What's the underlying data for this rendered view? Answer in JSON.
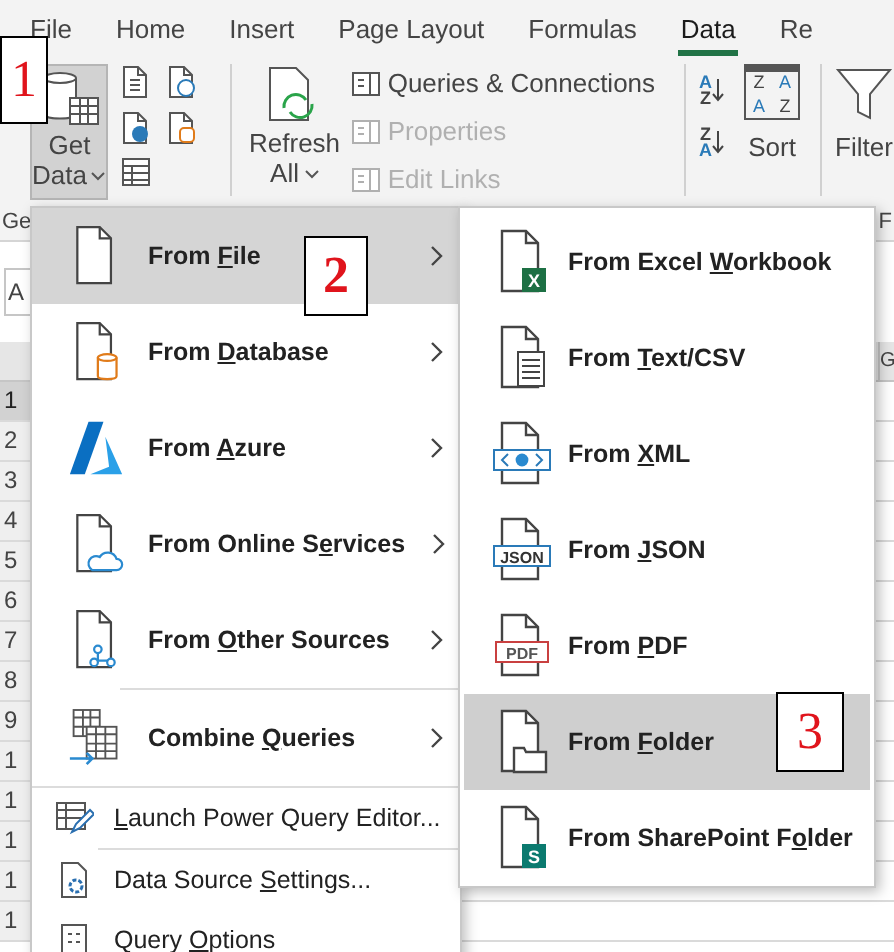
{
  "tabs": [
    {
      "label": "File",
      "selected": false
    },
    {
      "label": "Home",
      "selected": false
    },
    {
      "label": "Insert",
      "selected": false
    },
    {
      "label": "Page Layout",
      "selected": false
    },
    {
      "label": "Formulas",
      "selected": false
    },
    {
      "label": "Data",
      "selected": true
    },
    {
      "label": "Re",
      "selected": false
    }
  ],
  "ribbon": {
    "get_data": {
      "line1": "Get",
      "line2": "Data",
      "pressed": true
    },
    "refresh_all": {
      "line1": "Refresh",
      "line2": "All"
    },
    "commands": [
      {
        "label": "Queries & Connections",
        "disabled": false
      },
      {
        "label": "Properties",
        "disabled": true
      },
      {
        "label": "Edit Links",
        "disabled": true
      }
    ],
    "sort_ascending_letters": [
      "A",
      "Z"
    ],
    "sort_descending_letters": [
      "Z",
      "A"
    ],
    "sort_icon_letters": [
      "Z",
      "A",
      "A",
      "Z"
    ],
    "sort": "Sort",
    "filter": "Filter",
    "group_labels": [
      "Ge",
      "F"
    ]
  },
  "sheet": {
    "name_box": "A",
    "column_header": "G",
    "row_numbers": [
      {
        "label": "1",
        "selected": true
      },
      {
        "label": "2",
        "selected": false
      },
      {
        "label": "3",
        "selected": false
      },
      {
        "label": "4",
        "selected": false
      },
      {
        "label": "5",
        "selected": false
      },
      {
        "label": "6",
        "selected": false
      },
      {
        "label": "7",
        "selected": false
      },
      {
        "label": "8",
        "selected": false
      },
      {
        "label": "9",
        "selected": false
      },
      {
        "label": "1",
        "selected": false
      },
      {
        "label": "1",
        "selected": false
      },
      {
        "label": "1",
        "selected": false
      },
      {
        "label": "1",
        "selected": false
      },
      {
        "label": "1",
        "selected": false
      }
    ]
  },
  "menu": {
    "items": [
      {
        "kind": "large",
        "pre": "From ",
        "key": "F",
        "post": "ile",
        "has_submenu": true,
        "selected": true
      },
      {
        "kind": "large",
        "pre": "From ",
        "key": "D",
        "post": "atabase",
        "has_submenu": true,
        "selected": false
      },
      {
        "kind": "large",
        "pre": "From ",
        "key": "A",
        "post": "zure",
        "has_submenu": true,
        "selected": false
      },
      {
        "kind": "large",
        "pre": "From Online S",
        "key": "e",
        "post": "rvices",
        "has_submenu": true,
        "selected": false
      },
      {
        "kind": "large",
        "pre": "From ",
        "key": "O",
        "post": "ther Sources",
        "has_submenu": true,
        "selected": false
      },
      {
        "kind": "large",
        "pre": "Combine ",
        "key": "Q",
        "post": "ueries",
        "has_submenu": true,
        "selected": false
      },
      {
        "kind": "small",
        "key": "L",
        "post": "aunch Power Query Editor...",
        "has_submenu": false,
        "selected": false
      },
      {
        "kind": "small",
        "pre": "Data Source ",
        "key": "S",
        "post": "ettings...",
        "has_submenu": false,
        "selected": false
      },
      {
        "kind": "small",
        "pre": "Query ",
        "key": "O",
        "post": "ptions",
        "has_submenu": false,
        "selected": false
      }
    ]
  },
  "submenu": {
    "items": [
      {
        "pre": "From Excel ",
        "key": "W",
        "post": "orkbook",
        "icon_text": "X",
        "selected": false
      },
      {
        "pre": "From ",
        "key": "T",
        "post": "ext/CSV",
        "selected": false
      },
      {
        "pre": "From ",
        "key": "X",
        "post": "ML",
        "selected": false
      },
      {
        "pre": "From ",
        "key": "J",
        "post": "SON",
        "icon_text": "JSON",
        "selected": false
      },
      {
        "pre": "From ",
        "key": "P",
        "post": "DF",
        "icon_text": "PDF",
        "selected": false
      },
      {
        "pre": "From ",
        "key": "F",
        "post": "older",
        "selected": true
      },
      {
        "pre": "From SharePoint F",
        "key": "o",
        "post": "lder",
        "icon_text": "S",
        "selected": false
      }
    ]
  },
  "callouts": [
    {
      "text": "1"
    },
    {
      "text": "2"
    },
    {
      "text": "3"
    }
  ]
}
